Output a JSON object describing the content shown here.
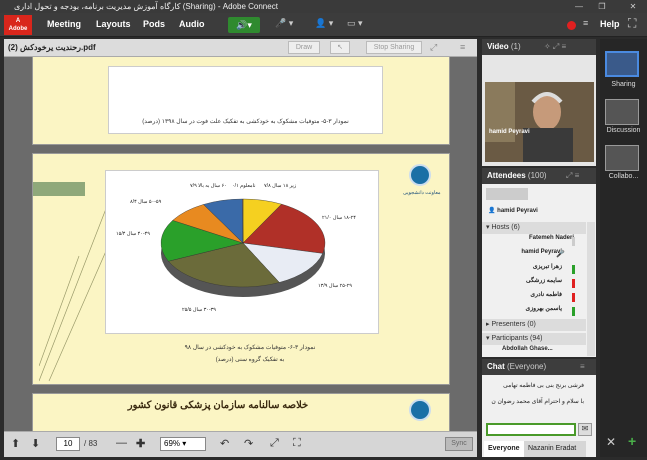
{
  "window": {
    "title": "کارگاه آموزش مدیریت برنامه، بودجه و تحول اداری (Sharing) - Adobe Connect"
  },
  "menu": {
    "logo": "Adobe",
    "items": [
      "Meeting",
      "Layouts",
      "Pods",
      "Audio"
    ],
    "help": "Help"
  },
  "share": {
    "filename": "رحندیت یرخودکش (2).pdf",
    "draw_label": "Draw",
    "stop_label": "Stop Sharing",
    "page_current": "10",
    "page_total": "/ 83",
    "zoom": "69%",
    "sync_label": "Sync",
    "slide1_caption": "نمودار ۳-۵- متوفیات مشکوک به خودکشی به تفکیک علت فوت در سال ۱۳۹۸ (درصد)",
    "slide2_caption_line1": "نمودار ۳-۶- متوفیات مشکوک به خودکشی در سال ۹۸",
    "slide2_caption_line2": "به تفکیک گروه سنی (درصد)",
    "logo_label": "معاونت دانشجویی",
    "slide3_title": "خلاصه سالنامه سازمان پزشکی قانون کشور"
  },
  "chart_data": {
    "type": "pie",
    "categories": [
      "زیر ۱۸ سال",
      "۱۸-۲۴ سال",
      "۲۵-۲۹ سال",
      "۳۰-۳۹ سال",
      "۴۰-۴۹ سال",
      "۵۰-۵۹ سال",
      "۶۰ سال به بالا",
      "نامعلوم"
    ],
    "labels": [
      "زیر ۱۸ سال ۷/۸",
      "۱۸-۲۴ سال ۲۱/۰",
      "۲۵-۲۹ سال ۱۳/۹",
      "۳۰-۳۹ سال ۲۵/۵",
      "۴۰-۴۹ سال ۱۵/۴",
      "۵۰-۵۹ سال ۸/۴",
      "۶۰ سال به بالا ۷/۹",
      "نامعلوم ۰/۱"
    ],
    "values": [
      7.8,
      21.0,
      13.9,
      25.5,
      15.4,
      8.4,
      7.9,
      0.1
    ],
    "colors": [
      "#f5d020",
      "#b03028",
      "#e8ecf4",
      "#6b6b3a",
      "#2aa02a",
      "#e88a20",
      "#3a6aa8",
      "#f0a0a0"
    ]
  },
  "video": {
    "title": "Video",
    "count": "(1)",
    "presenter": "hamid Peyravi"
  },
  "attendees": {
    "title": "Attendees",
    "count": "(100)",
    "me": "hamid Peyravi",
    "hosts_label": "Hosts (6)",
    "hosts": [
      "Fatemeh Naderi",
      "hamid Peyravi",
      "زهرا تبریزی",
      "سایمه زرشگی",
      "فاطمه نادری",
      "یاسمن بهروزی"
    ],
    "host_status_colors": [
      "#cccccc",
      "#cccccc",
      "#2aa02a",
      "#e02020",
      "#e02020",
      "#2aa02a"
    ],
    "presenters_label": "Presenters (0)",
    "participants_label": "Participants (94)",
    "first_participant": "Abdollah Ghase..."
  },
  "chat": {
    "title": "Chat",
    "scope": "(Everyone)",
    "messages": [
      "فرشی برنج بنی بی فاطمه تهامی",
      "با سلام و احترام آقای محمد رضوان ن"
    ],
    "tabs": [
      "Everyone",
      "Nazanin Eradat"
    ]
  },
  "layouts": {
    "items": [
      "Sharing",
      "Discussion",
      "Collabo..."
    ]
  }
}
